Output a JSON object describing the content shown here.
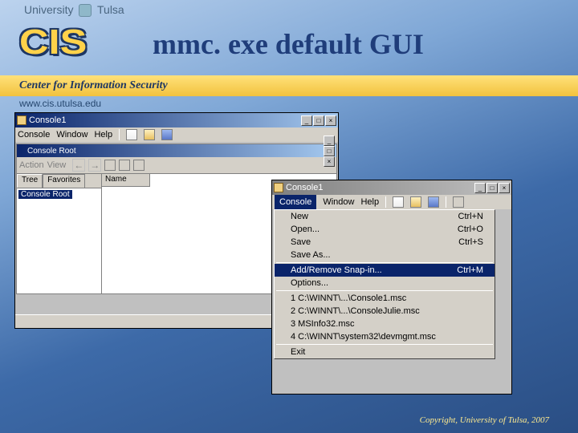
{
  "header": {
    "university_text_left": "University",
    "university_text_right": "Tulsa",
    "cis": "CIS",
    "slide_title": "mmc. exe default GUI",
    "center_label": "Center for Information Security",
    "url": "www.cis.utulsa.edu"
  },
  "win1": {
    "title": "Console1",
    "menubar": [
      "Console",
      "Window",
      "Help"
    ],
    "inner_title": "Console Root",
    "inner_tool_left": "Action",
    "inner_tool_view": "View",
    "tabs": [
      "Tree",
      "Favorites"
    ],
    "tree_item": "Console Root",
    "col_name": "Name"
  },
  "win2": {
    "title": "Console1",
    "menubar": [
      "Console",
      "Window",
      "Help"
    ],
    "selected_menu": "Console",
    "menu_items": [
      {
        "label": "New",
        "accel": "Ctrl+N"
      },
      {
        "label": "Open...",
        "accel": "Ctrl+O"
      },
      {
        "label": "Save",
        "accel": "Ctrl+S"
      },
      {
        "label": "Save As...",
        "accel": ""
      }
    ],
    "menu_items2": [
      {
        "label": "Add/Remove Snap-in...",
        "accel": "Ctrl+M",
        "highlight": true
      },
      {
        "label": "Options...",
        "accel": ""
      }
    ],
    "recent": [
      "1 C:\\WINNT\\...\\Console1.msc",
      "2 C:\\WINNT\\...\\ConsoleJulie.msc",
      "3 MSInfo32.msc",
      "4 C:\\WINNT\\system32\\devmgmt.msc"
    ],
    "exit_label": "Exit"
  },
  "copyright": "Copyright, University of Tulsa, 2007"
}
